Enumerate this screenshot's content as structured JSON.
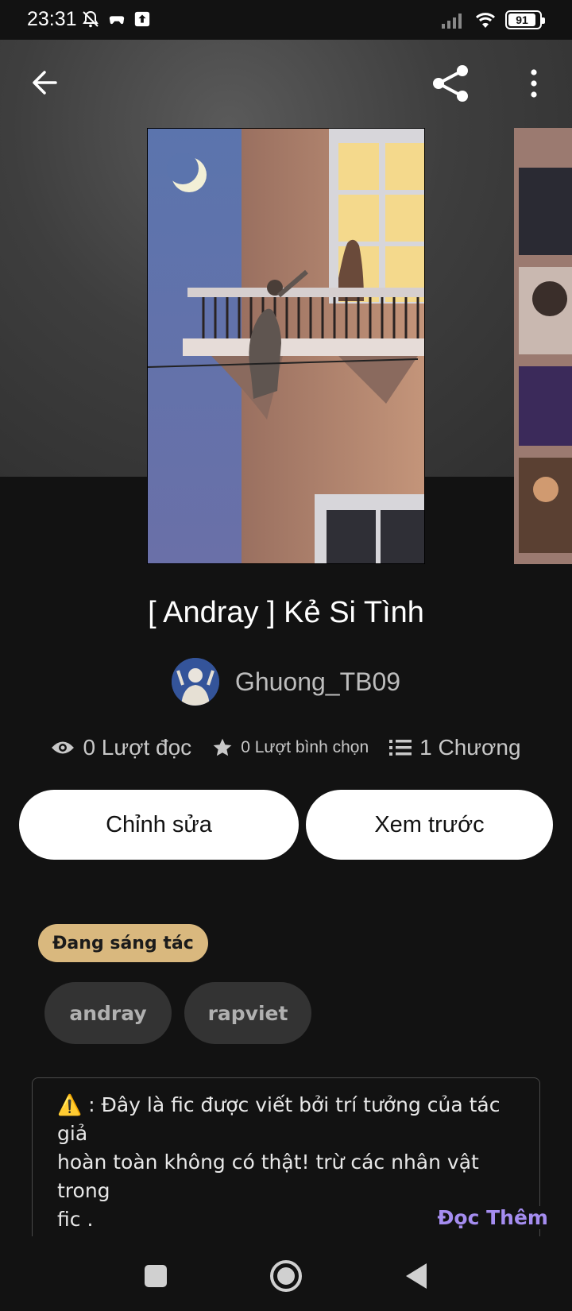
{
  "status_bar": {
    "time": "23:31",
    "battery": "91",
    "icons": [
      "bell-off-icon",
      "gamepad-icon",
      "upload-icon",
      "signal-icon",
      "wifi-icon",
      "battery-icon"
    ]
  },
  "toolbar": {
    "back_icon": "arrow-left-icon",
    "share_icon": "share-icon",
    "more_icon": "more-vertical-icon"
  },
  "story": {
    "title": "[ Andray ]  Kẻ Si Tình",
    "author": "Ghuong_TB09",
    "reads": "0 Lượt đọc",
    "votes": "0 Lượt bình chọn",
    "chapters": "1 Chương"
  },
  "actions": {
    "edit_label": "Chỉnh sửa",
    "preview_label": "Xem trước"
  },
  "status_tag": "Đang sáng tác",
  "tags": [
    "andray",
    "rapviet"
  ],
  "description": {
    "warning_icon": "⚠️",
    "text": ": Đây là fic được viết bởi trí tưởng của tác giả\nhoàn toàn không có thật! trừ các nhân vật trong\nfic .\nMong các bạn không đem fic đi đâu khi chưa",
    "read_more": "Đọc Thêm"
  },
  "nav": {
    "recents_icon": "square-icon",
    "home_icon": "circle-home-icon",
    "back_icon": "triangle-back-icon"
  },
  "colors": {
    "background": "#121212",
    "tag_status": "#d9b87e",
    "tag_chip": "#333333",
    "read_more": "#a58df0"
  }
}
